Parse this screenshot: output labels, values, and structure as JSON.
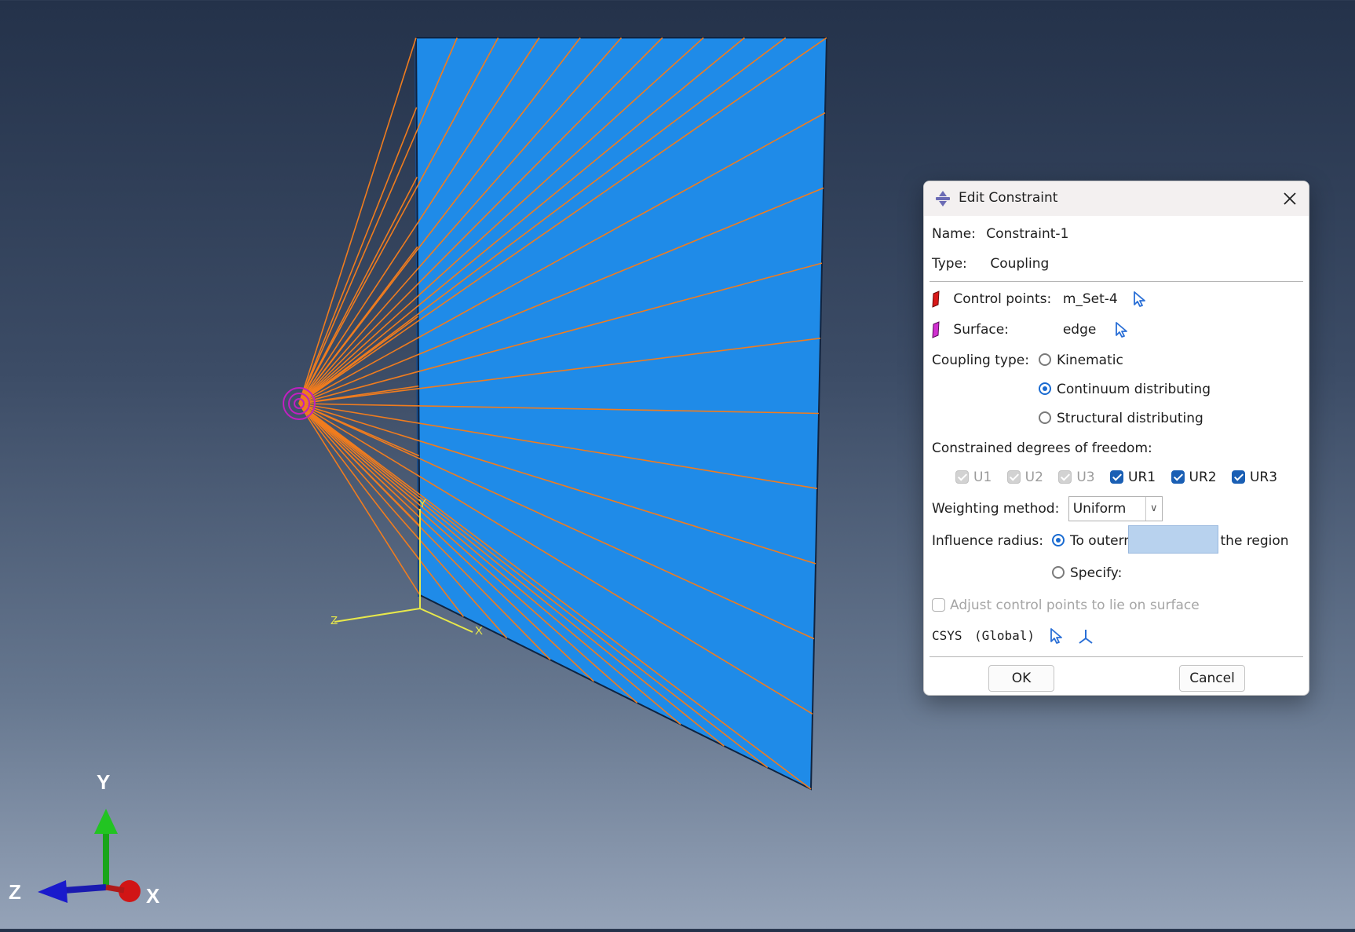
{
  "viewport": {
    "triad": {
      "x_label": "X",
      "y_label": "Y",
      "z_label": "Z"
    },
    "local_csys": {
      "x_label": "X",
      "y_label": "Y",
      "z_label": "Z"
    },
    "colors": {
      "surface": "#1f8be8",
      "coupling_lines": "#f07c1e",
      "control_point": "#c020c0"
    }
  },
  "dialog": {
    "title": "Edit Constraint",
    "name_label": "Name:",
    "name_value": "Constraint-1",
    "type_label": "Type:",
    "type_value": "Coupling",
    "control_points_label": "Control points:",
    "control_points_value": "m_Set-4",
    "surface_label": "Surface:",
    "surface_value": "edge",
    "coupling_type_label": "Coupling type:",
    "coupling_options": [
      {
        "label": "Kinematic",
        "selected": false
      },
      {
        "label": "Continuum distributing",
        "selected": true
      },
      {
        "label": "Structural distributing",
        "selected": false
      }
    ],
    "dof_label": "Constrained degrees of freedom:",
    "dofs": [
      {
        "label": "U1",
        "checked": true,
        "enabled": false
      },
      {
        "label": "U2",
        "checked": true,
        "enabled": false
      },
      {
        "label": "U3",
        "checked": true,
        "enabled": false
      },
      {
        "label": "UR1",
        "checked": true,
        "enabled": true
      },
      {
        "label": "UR2",
        "checked": true,
        "enabled": true
      },
      {
        "label": "UR3",
        "checked": true,
        "enabled": true
      }
    ],
    "weighting_label": "Weighting method:",
    "weighting_value": "Uniform",
    "influence_label": "Influence radius:",
    "influence_options": [
      {
        "label": "To outermost point on the region",
        "selected": true
      },
      {
        "label": "Specify:",
        "selected": false
      }
    ],
    "specify_value": "",
    "adjust_label": "Adjust control points to lie on surface",
    "adjust_checked": false,
    "csys_label": "CSYS",
    "csys_value": "(Global)",
    "ok_label": "OK",
    "cancel_label": "Cancel"
  }
}
